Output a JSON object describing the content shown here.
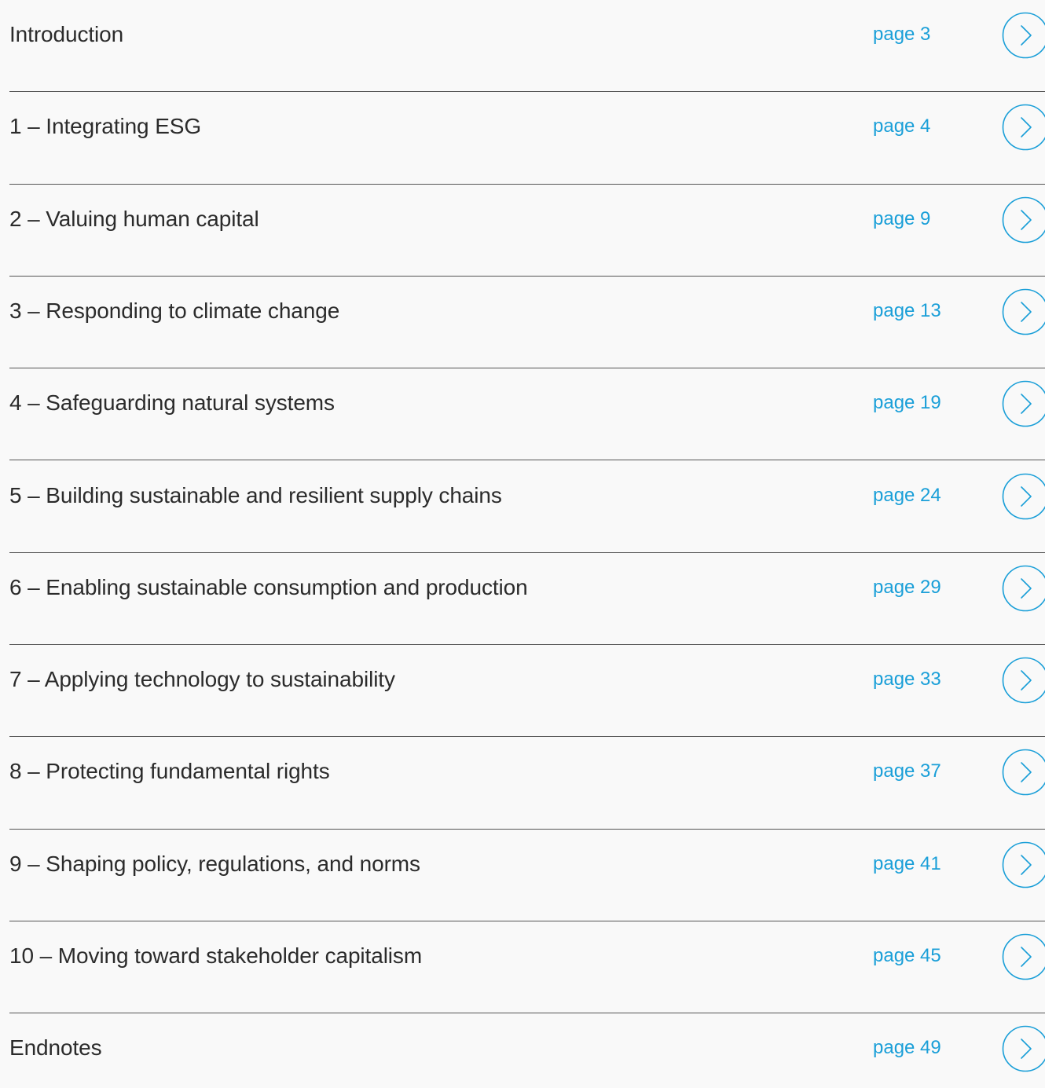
{
  "accent_color": "#1a9fd8",
  "text_color": "#2b2b2b",
  "divider_color": "#555555",
  "arrow_icon": "chevron-right-circle-icon",
  "entries": [
    {
      "title": "Introduction",
      "page": "page 3"
    },
    {
      "title": "1 – Integrating ESG",
      "page": "page 4"
    },
    {
      "title": "2 – Valuing human capital",
      "page": "page 9"
    },
    {
      "title": "3 – Responding to climate change",
      "page": "page 13"
    },
    {
      "title": "4 – Safeguarding natural systems",
      "page": "page 19"
    },
    {
      "title": "5 – Building sustainable and resilient supply chains",
      "page": "page 24"
    },
    {
      "title": "6 – Enabling sustainable consumption and production",
      "page": "page 29"
    },
    {
      "title": "7 – Applying technology to sustainability",
      "page": "page 33"
    },
    {
      "title": "8 – Protecting fundamental rights",
      "page": "page 37"
    },
    {
      "title": "9 – Shaping policy, regulations, and norms",
      "page": "page 41"
    },
    {
      "title": "10 – Moving toward stakeholder capitalism",
      "page": "page 45"
    },
    {
      "title": "Endnotes",
      "page": "page 49"
    }
  ]
}
